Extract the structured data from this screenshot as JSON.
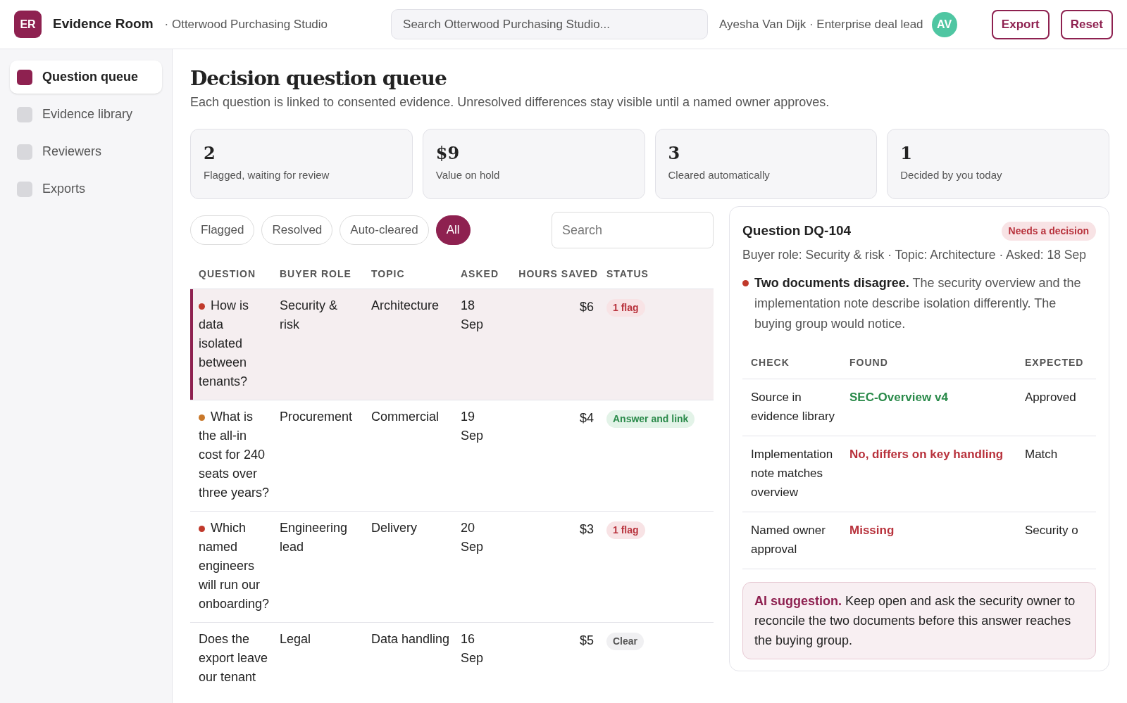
{
  "app": {
    "logo": "ER",
    "title": "Evidence Room",
    "org": "· Otterwood Purchasing Studio"
  },
  "search": {
    "placeholder": "Search Otterwood Purchasing Studio..."
  },
  "user": {
    "label": "Ayesha Van Dijk · Enterprise deal lead",
    "initials": "AV"
  },
  "header_buttons": [
    "Export",
    "Reset"
  ],
  "sidebar": {
    "items": [
      {
        "label": "Question queue",
        "selected": true
      },
      {
        "label": "Evidence library",
        "selected": false
      },
      {
        "label": "Reviewers",
        "selected": false
      },
      {
        "label": "Exports",
        "selected": false
      }
    ]
  },
  "page": {
    "title": "Decision question queue",
    "subtitle": "Each question is linked to consented evidence. Unresolved differences stay visible until a named owner approves."
  },
  "stats": [
    {
      "value": "2",
      "label": "Flagged, waiting for review"
    },
    {
      "value": "$9",
      "label": "Value on hold"
    },
    {
      "value": "3",
      "label": "Cleared automatically"
    },
    {
      "value": "1",
      "label": "Decided by you today"
    }
  ],
  "filters": [
    {
      "label": "Flagged",
      "selected": false
    },
    {
      "label": "Resolved",
      "selected": false
    },
    {
      "label": "Auto-cleared",
      "selected": false
    },
    {
      "label": "All",
      "selected": true
    }
  ],
  "table_search": {
    "placeholder": "Search"
  },
  "table": {
    "columns": [
      "QUESTION",
      "BUYER ROLE",
      "TOPIC",
      "ASKED",
      "HOURS SAVED",
      "STATUS"
    ],
    "rows": [
      {
        "selected": true,
        "color": "#c0392b",
        "question": "How is data isolated between tenants?",
        "buyer_role": "Security & risk",
        "topic": "Architecture",
        "asked": "18 Sep",
        "hours_saved": "$6",
        "status": {
          "kind": "flag",
          "label": "1 flag"
        }
      },
      {
        "selected": false,
        "color": "#c9782a",
        "question": "What is the all-in cost for 240 seats over three years?",
        "buyer_role": "Procurement",
        "topic": "Commercial",
        "asked": "19 Sep",
        "hours_saved": "$4",
        "status": {
          "kind": "answer",
          "label": "Answer and link"
        }
      },
      {
        "selected": false,
        "color": "#c0392b",
        "question": "Which named engineers will run our onboarding?",
        "buyer_role": "Engineering lead",
        "topic": "Delivery",
        "asked": "20 Sep",
        "hours_saved": "$3",
        "status": {
          "kind": "flag",
          "label": "1 flag"
        }
      },
      {
        "selected": false,
        "question": "Does the export leave our tenant",
        "buyer_role": "Legal",
        "topic": "Data handling",
        "asked": "16 Sep",
        "hours_saved": "$5",
        "status": {
          "kind": "clear",
          "label": "Clear"
        }
      }
    ]
  },
  "detail": {
    "title": "Question DQ-104",
    "badge": "Needs a decision",
    "meta": "Buyer role: Security & risk · Topic: Architecture · Asked: 18 Sep",
    "alert": "**Two documents disagree.** The security overview and the implementation note describe isolation differently. The buying group would notice.",
    "checks": {
      "columns": [
        "CHECK",
        "FOUND",
        "EXPECTED"
      ],
      "rows": [
        {
          "check": "Source in evidence library",
          "found": "SEC-Overview v4",
          "kind": "ok",
          "expected": "Approved"
        },
        {
          "check": "Implementation note matches overview",
          "found": "No, differs on key handling",
          "kind": "bad",
          "expected": "Match"
        },
        {
          "check": "Named owner approval",
          "found": "Missing",
          "kind": "bad",
          "expected": "Security o"
        }
      ]
    },
    "suggestion": "**AI suggestion.** Keep open and ask the security owner to reconcile the two documents before this answer reaches the buying group."
  }
}
